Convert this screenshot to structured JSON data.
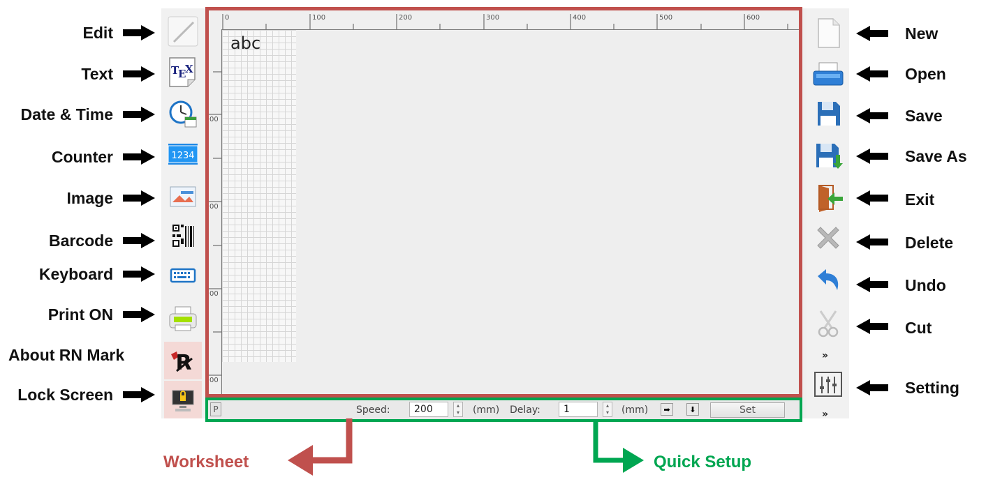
{
  "left_labels": [
    "Edit",
    "Text",
    "Date & Time",
    "Counter",
    "Image",
    "Barcode",
    "Keyboard",
    "Print ON",
    "About RN Mark",
    "Lock Screen"
  ],
  "right_labels": [
    "New",
    "Open",
    "Save",
    "Save As",
    "Exit",
    "Delete",
    "Undo",
    "Cut",
    "Setting"
  ],
  "left_tools": [
    {
      "icon": "edit-icon"
    },
    {
      "icon": "tex-icon"
    },
    {
      "icon": "clock-icon"
    },
    {
      "icon": "counter-icon",
      "text": "1234"
    },
    {
      "icon": "image-icon"
    },
    {
      "icon": "barcode-icon"
    },
    {
      "icon": "keyboard-icon"
    },
    {
      "icon": "printer-icon"
    },
    {
      "icon": "rn-logo-icon",
      "text": "R"
    },
    {
      "icon": "lock-screen-icon"
    }
  ],
  "right_tools": [
    {
      "icon": "new-file-icon"
    },
    {
      "icon": "open-icon"
    },
    {
      "icon": "save-icon"
    },
    {
      "icon": "save-as-icon"
    },
    {
      "icon": "exit-icon"
    },
    {
      "icon": "delete-icon"
    },
    {
      "icon": "undo-icon"
    },
    {
      "icon": "cut-icon"
    },
    {
      "icon": "setting-icon"
    }
  ],
  "tex_label": {
    "t": "T",
    "e": "E",
    "x": "X"
  },
  "ruler": {
    "top_ticks": [
      "0",
      "100",
      "200",
      "300",
      "400",
      "500",
      "600"
    ],
    "left_ticks": [
      "00",
      "00",
      "00",
      "00"
    ]
  },
  "worksheet": {
    "text": "abc"
  },
  "quick_setup": {
    "p_label": "P",
    "speed_label": "Speed:",
    "speed_value": "200",
    "speed_unit": "(mm)",
    "delay_label": "Delay:",
    "delay_value": "1",
    "delay_unit": "(mm)",
    "set_label": "Set"
  },
  "captions": {
    "worksheet": "Worksheet",
    "quick_setup": "Quick Setup"
  },
  "colors": {
    "worksheet": "#c0504d",
    "quick_setup": "#00a651",
    "arrow": "#000000"
  }
}
